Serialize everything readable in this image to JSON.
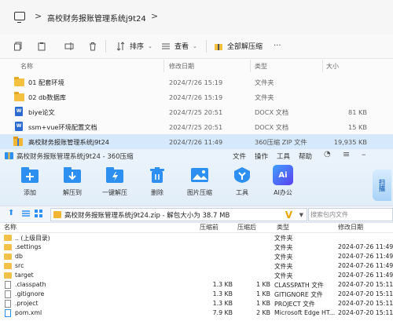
{
  "explorer": {
    "breadcrumb": {
      "separator": ">",
      "current": "高校财务报账管理系统j9t24",
      "more": ">"
    },
    "commands": {
      "sort": "排序",
      "view": "查看",
      "extract_all": "全部解压缩",
      "more": "···"
    },
    "columns": {
      "name": "名称",
      "modified": "修改日期",
      "type": "类型",
      "size": "大小"
    },
    "files": [
      {
        "icon": "folder-icon",
        "name": "01 配套环境",
        "modified": "2024/7/26 15:19",
        "type": "文件夹",
        "size": ""
      },
      {
        "icon": "folder-icon",
        "name": "02 db数据库",
        "modified": "2024/7/26 15:19",
        "type": "文件夹",
        "size": ""
      },
      {
        "icon": "docx-icon",
        "name": "biye论文",
        "modified": "2024/7/25 20:51",
        "type": "DOCX 文档",
        "size": "81 KB"
      },
      {
        "icon": "docx-icon",
        "name": "ssm+vue环境配置文档",
        "modified": "2024/7/25 20:51",
        "type": "DOCX 文档",
        "size": "15 KB"
      },
      {
        "icon": "zip-icon",
        "name": "高校财务报账管理系统j9t24",
        "modified": "2024/7/26 11:49",
        "type": "360压缩 ZIP 文件",
        "size": "19,935 KB",
        "selected": true
      }
    ]
  },
  "zip": {
    "title": "高校财务报账管理系统j9t24 - 360压缩",
    "menu": {
      "file": "文件",
      "ops": "操作",
      "tools": "工具",
      "help": "帮助"
    },
    "tools": [
      {
        "icon": "add-icon",
        "label": "添加",
        "color": "#2d8ff0"
      },
      {
        "icon": "extract-to-icon",
        "label": "解压到",
        "color": "#2d8ff0"
      },
      {
        "icon": "one-click-extract-icon",
        "label": "一键解压",
        "color": "#2d8ff0"
      },
      {
        "icon": "delete-icon",
        "label": "删除",
        "color": "#2d8ff0"
      },
      {
        "icon": "image-compress-icon",
        "label": "图片压缩",
        "color": "#2d8ff0"
      },
      {
        "icon": "tools-icon",
        "label": "工具",
        "color": "#2d8ff0"
      },
      {
        "icon": "ai-icon",
        "label": "AI办公",
        "color": "#2f6bf2"
      }
    ],
    "scan": "扫描",
    "path": "高校财务报账管理系统j9t24.zip - 解包大小为 38.7 MB",
    "search_placeholder": "搜索包内文件",
    "columns": {
      "name": "名称",
      "before": "压缩前",
      "after": "压缩后",
      "type": "类型",
      "modified": "修改日期"
    },
    "rows": [
      {
        "kind": "folder",
        "name": ".. (上级目录)",
        "before": "",
        "after": "",
        "type": "文件夹",
        "modified": ""
      },
      {
        "kind": "folder",
        "name": ".settings",
        "before": "",
        "after": "",
        "type": "文件夹",
        "modified": "2024-07-26 11:49"
      },
      {
        "kind": "folder",
        "name": "db",
        "before": "",
        "after": "",
        "type": "文件夹",
        "modified": "2024-07-26 11:49"
      },
      {
        "kind": "folder",
        "name": "src",
        "before": "",
        "after": "",
        "type": "文件夹",
        "modified": "2024-07-26 11:49"
      },
      {
        "kind": "folder",
        "name": "target",
        "before": "",
        "after": "",
        "type": "文件夹",
        "modified": "2024-07-26 11:49"
      },
      {
        "kind": "file",
        "name": ".classpath",
        "before": "1.3 KB",
        "after": "1 KB",
        "type": "CLASSPATH 文件",
        "modified": "2024-07-20 15:11"
      },
      {
        "kind": "file",
        "name": ".gitignore",
        "before": "1.3 KB",
        "after": "1 KB",
        "type": "GITIGNORE 文件",
        "modified": "2024-07-20 15:11"
      },
      {
        "kind": "file",
        "name": ".project",
        "before": "1.3 KB",
        "after": "1 KB",
        "type": "PROJECT 文件",
        "modified": "2024-07-20 15:11"
      },
      {
        "kind": "file",
        "name": "pom.xml",
        "before": "7.9 KB",
        "after": "2 KB",
        "type": "Microsoft Edge HT...",
        "modified": "2024-07-20 15:11"
      }
    ]
  }
}
